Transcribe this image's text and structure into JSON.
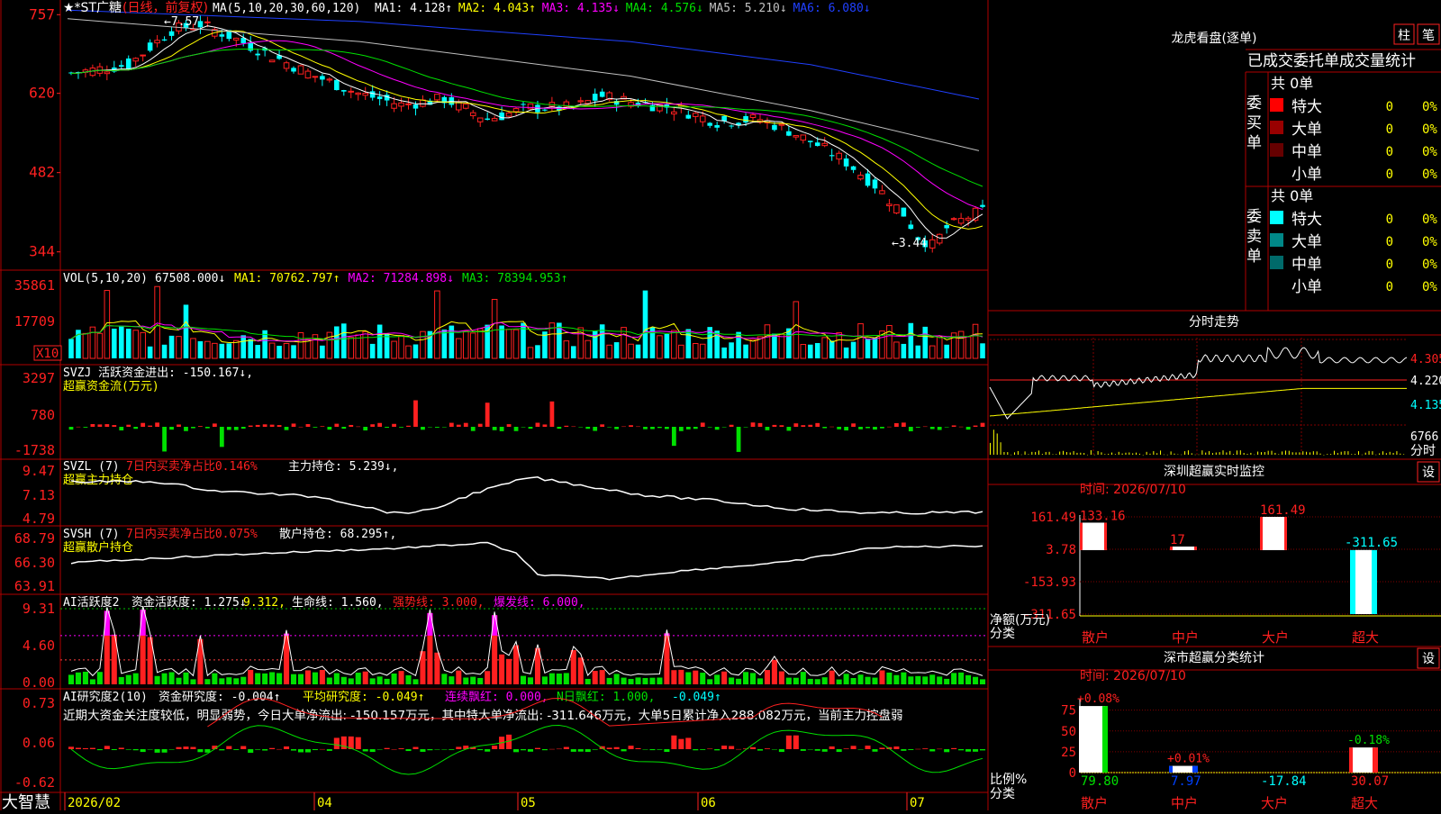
{
  "main": {
    "title": "★*ST广糖",
    "mode": "(日线，前复权)",
    "ma_label": "MA(5,10,20,30,60,120)",
    "ma_values": [
      {
        "label": "MA1: 4.128↑",
        "color": "#ffffff"
      },
      {
        "label": "MA2: 4.043↑",
        "color": "#ffff00"
      },
      {
        "label": "MA3: 4.135↓",
        "color": "#ff00ff"
      },
      {
        "label": "MA4: 4.576↓",
        "color": "#00e000"
      },
      {
        "label": "MA5: 5.210↓",
        "color": "#c0c0c0"
      },
      {
        "label": "MA6: 6.080↓",
        "color": "#2040ff"
      }
    ],
    "y_ticks": [
      "757",
      "620",
      "482",
      "344"
    ],
    "high_note": "←7.57",
    "low_note": "←3.44"
  },
  "vol": {
    "label": "VOL(5,10,20)",
    "value": "67508.000↓",
    "mas": [
      {
        "label": "MA1: 70762.797↑",
        "color": "#ffff00"
      },
      {
        "label": "MA2: 71284.898↓",
        "color": "#ff00ff"
      },
      {
        "label": "MA3: 78394.953↑",
        "color": "#00e000"
      }
    ],
    "y_ticks": [
      "35861",
      "17709"
    ],
    "unit": "X10"
  },
  "svzj": {
    "label": "SVZJ  活跃资金进出: -150.167↓,",
    "sub": "超赢资金流(万元)",
    "y_ticks": [
      "3297",
      "780",
      "-1738"
    ]
  },
  "svzl": {
    "label": "SVZL (7)",
    "red_text": "7日内买卖净占比0.146%",
    "white_text": "主力持仓: 5.239↓,",
    "sub": "超赢主力持仓",
    "y_ticks": [
      "9.47",
      "7.13",
      "4.79"
    ]
  },
  "svsh": {
    "label": "SVSH (7)",
    "red_text": "7日内买卖净占比0.075%",
    "white_text": "散户持仓: 68.295↑,",
    "sub": "超赢散户持仓",
    "y_ticks": [
      "68.79",
      "66.30",
      "63.91"
    ]
  },
  "ai1": {
    "label": "AI活跃度2",
    "v1": "资金活跃度: 1.275↓",
    "v2": "9.312,",
    "v3": "生命线: 1.560,",
    "v4": "强势线: 3.000,",
    "v5": "爆发线: 6.000,",
    "y_ticks": [
      "9.31",
      "4.60",
      "0.00"
    ]
  },
  "ai2": {
    "label": "AI研究度2(10)",
    "v1": "资金研究度: -0.004↑",
    "v2": "平均研究度: -0.049↑",
    "v3": "连续飘红: 0.000,",
    "v4": "N日飘红: 1.000,",
    "v5": "-0.049↑",
    "text": "近期大资金关注度较低，明显弱势，今日大单净流出: -150.157万元，其中特大单净流出: -311.646万元，大单5日累计净入288.082万元，当前主力控盘弱",
    "y_ticks": [
      "0.73",
      "0.06",
      "-0.62"
    ]
  },
  "x_axis": [
    "2026/02",
    "04",
    "05",
    "06",
    "07"
  ],
  "brand": "大智慧",
  "dragon": {
    "title": "龙虎看盘(逐单)",
    "btn1": "柱",
    "btn2": "笔",
    "header": "已成交委托单成交量统计",
    "buy_label": "委买单",
    "sell_label": "委卖单",
    "buy_total": "共 0单",
    "sell_total": "共 0单",
    "rows": [
      {
        "name": "特大",
        "count": "0",
        "pct": "0%"
      },
      {
        "name": "大单",
        "count": "0",
        "pct": "0%"
      },
      {
        "name": "中单",
        "count": "0",
        "pct": "0%"
      },
      {
        "name": "小单",
        "count": "0",
        "pct": "0%"
      }
    ],
    "buy_colors": [
      "#ff0000",
      "#990000",
      "#660000",
      "#000000"
    ],
    "sell_colors": [
      "#00ffff",
      "#008888",
      "#006a6a",
      "#000000"
    ]
  },
  "intraday": {
    "title": "分时走势",
    "y_ticks": [
      "4.305",
      "4.220",
      "4.135"
    ],
    "vol_tick": "6766",
    "footer": "分时"
  },
  "monitor": {
    "title": "深圳超赢实时监控",
    "btn": "设",
    "time": "时间: 2026/07/10",
    "y_ticks": [
      "161.49",
      "3.78",
      "-153.93",
      "-311.65"
    ],
    "ylabel": "净额(万元)",
    "xlabel": "分类",
    "categories": [
      "散户",
      "中户",
      "大户",
      "超大"
    ],
    "values": [
      133.16,
      17,
      161.49,
      -311.65
    ],
    "labels": [
      "133.16",
      "17",
      "161.49",
      "-311.65"
    ]
  },
  "classify": {
    "title": "深市超赢分类统计",
    "btn": "设",
    "time": "时间: 2026/07/10",
    "y_ticks": [
      "75",
      "50",
      "25",
      "0"
    ],
    "ylabel": "比例%",
    "xlabel": "分类",
    "categories": [
      "散户",
      "中户",
      "大户",
      "超大"
    ],
    "values": [
      79.8,
      7.97,
      -17.84,
      30.07
    ],
    "labels": [
      "79.80",
      "7.97",
      "-17.84",
      "30.07"
    ],
    "deltas": [
      "+0.08%",
      "+0.01%",
      "",
      "-0.18%"
    ]
  }
}
